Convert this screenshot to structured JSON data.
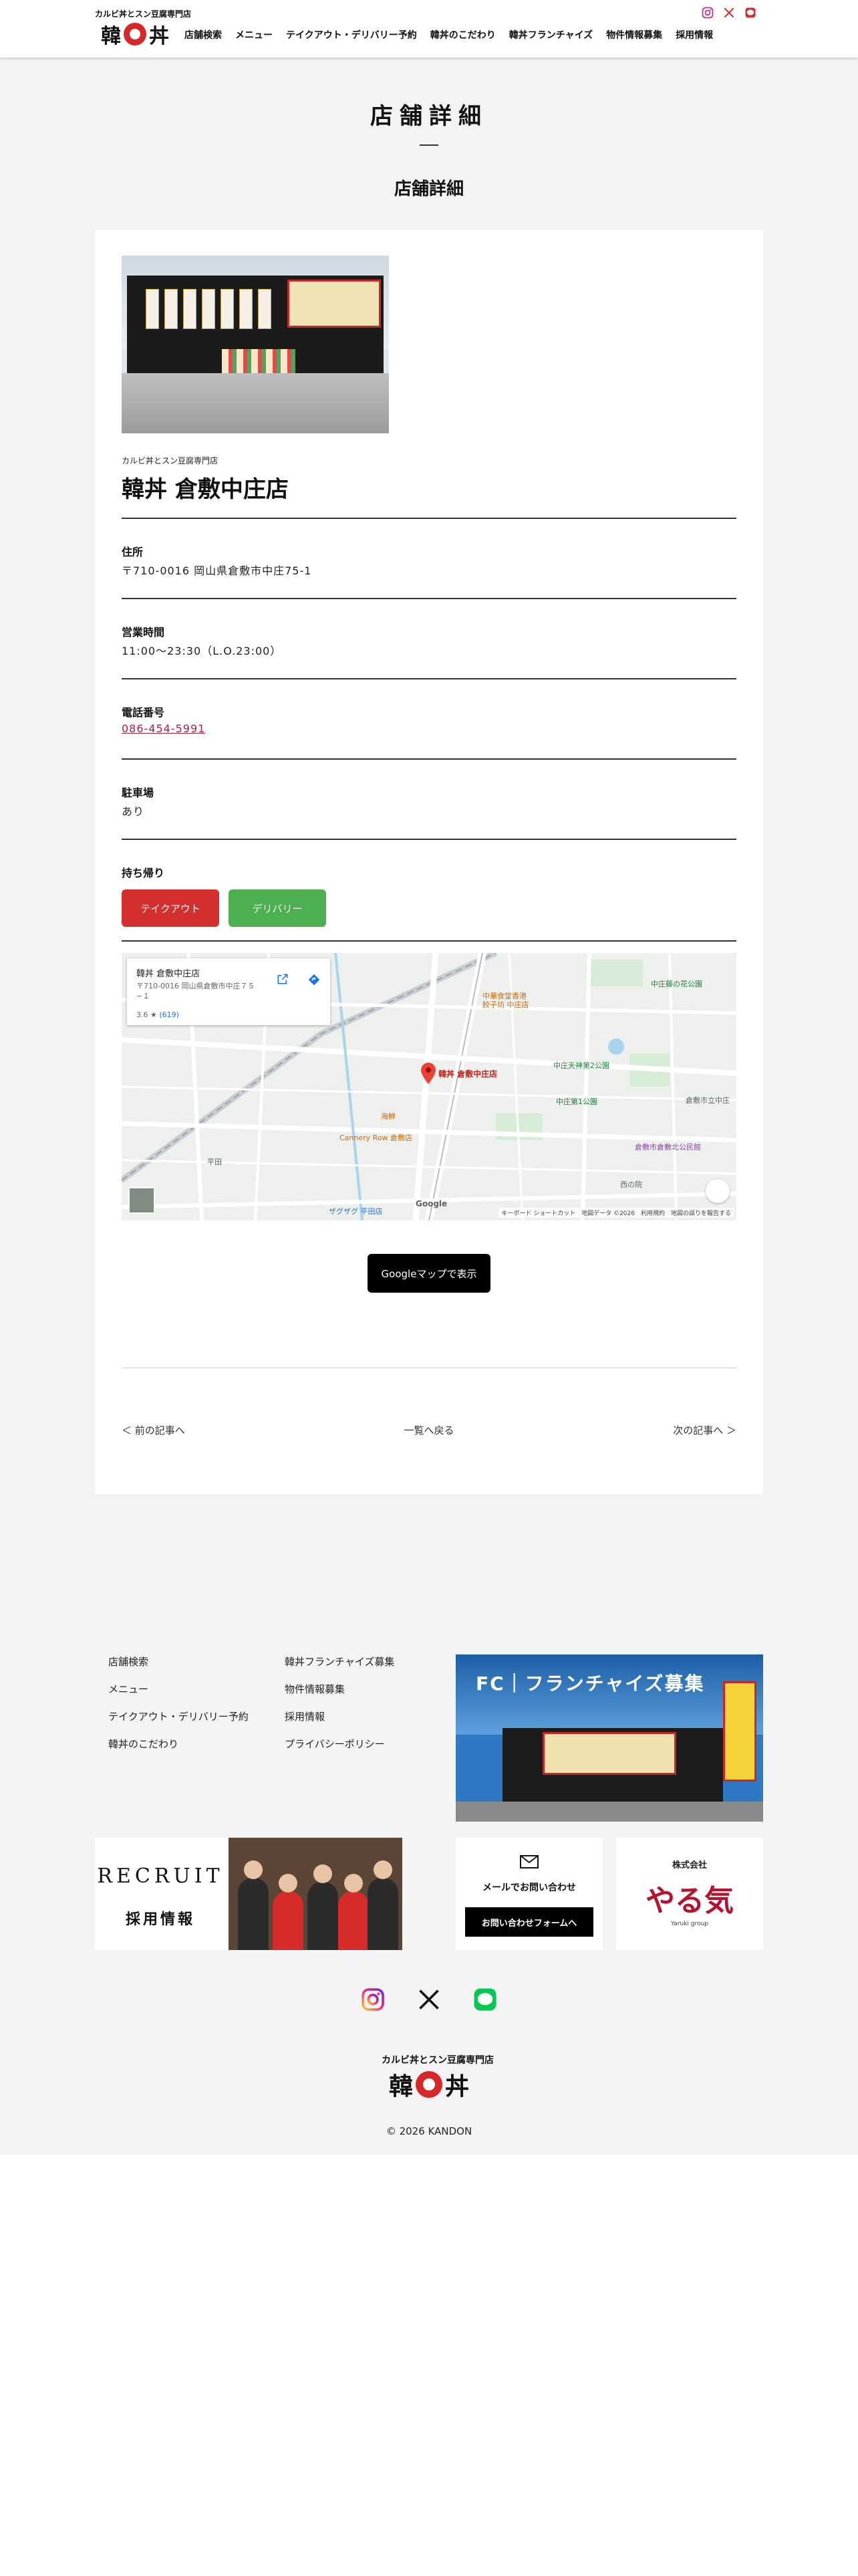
{
  "header": {
    "logo_sub": "カルビ丼とスン豆腐専門店",
    "logo_char1": "韓",
    "logo_char2": "丼",
    "social_icons": [
      "instagram-icon",
      "x-icon",
      "line-icon"
    ],
    "nav": [
      "店舗検索",
      "メニュー",
      "テイクアウト・デリバリー予約",
      "韓丼のこだわり",
      "韓丼フランチャイズ",
      "物件情報募集",
      "採用情報"
    ]
  },
  "page": {
    "title": "店舗詳細",
    "section_title": "店舗詳細"
  },
  "shop": {
    "category": "カルビ丼とスン豆腐専門店",
    "name": "韓丼 倉敷中庄店",
    "address_label": "住所",
    "address": "〒710-0016 岡山県倉敷市中庄75-1",
    "hours_label": "営業時間",
    "hours": "11:00〜23:30（L.O.23:00）",
    "phone_label": "電話番号",
    "phone": "086-454-5991",
    "parking_label": "駐車場",
    "parking": "あり",
    "takeout_label": "持ち帰り",
    "takeout_button": "テイクアウト",
    "delivery_button": "デリバリー"
  },
  "map": {
    "card_title": "韓丼 倉敷中庄店",
    "card_address": "〒710-0016 岡山県倉敷市中庄７５−１",
    "card_rating": "3.6",
    "card_reviews": "(619)",
    "pin_label": "韓丼 倉敷中庄店",
    "labels": {
      "hospital": "中華食堂香港 餃子坊 中庄店",
      "zhongzhuang_park": "中庄藤の花公園",
      "tenjin_park": "中庄天神第2公園",
      "third_park": "中庄第1公園",
      "school": "倉敷市立中庄",
      "cannery": "Cannery Row 倉敷店",
      "kaisen": "海鮮",
      "sports": "倉敷市倉敷北公民館",
      "zagzag": "ザグザグ 平田店",
      "hirata": "平田",
      "nishinoin": "西の院"
    },
    "google": "Google",
    "footer": "キーボード ショートカット　地図データ ©2026　利用規約　地図の誤りを報告する"
  },
  "gmap_button": "Googleマップで表示",
  "pager": {
    "prev": "＜ 前の記事へ",
    "list": "一覧へ戻る",
    "next": "次の記事へ ＞"
  },
  "footer": {
    "links_col1": [
      "店舗検索",
      "メニュー",
      "テイクアウト・デリバリー予約",
      "韓丼のこだわり"
    ],
    "links_col2": [
      "韓丼フランチャイズ募集",
      "物件情報募集",
      "採用情報",
      "プライバシーポリシー"
    ],
    "fc_banner": "FC｜フランチャイズ募集",
    "recruit_en": "RECRUIT",
    "recruit_jp": "採用情報",
    "contact_label": "メールでお問い合わせ",
    "contact_button": "お問い合わせフォームへ",
    "yaruki_company": "株式会社",
    "yaruki_main": "やる気",
    "yaruki_sub": "Yaruki group",
    "social_icons": [
      "instagram-icon",
      "x-icon",
      "line-icon"
    ],
    "copyright": "© 2026 KANDON"
  },
  "colors": {
    "takeout": "#d32f2f",
    "delivery": "#4caf50",
    "phone_link": "#b0203a",
    "main_bg": "#f3f3f3"
  }
}
